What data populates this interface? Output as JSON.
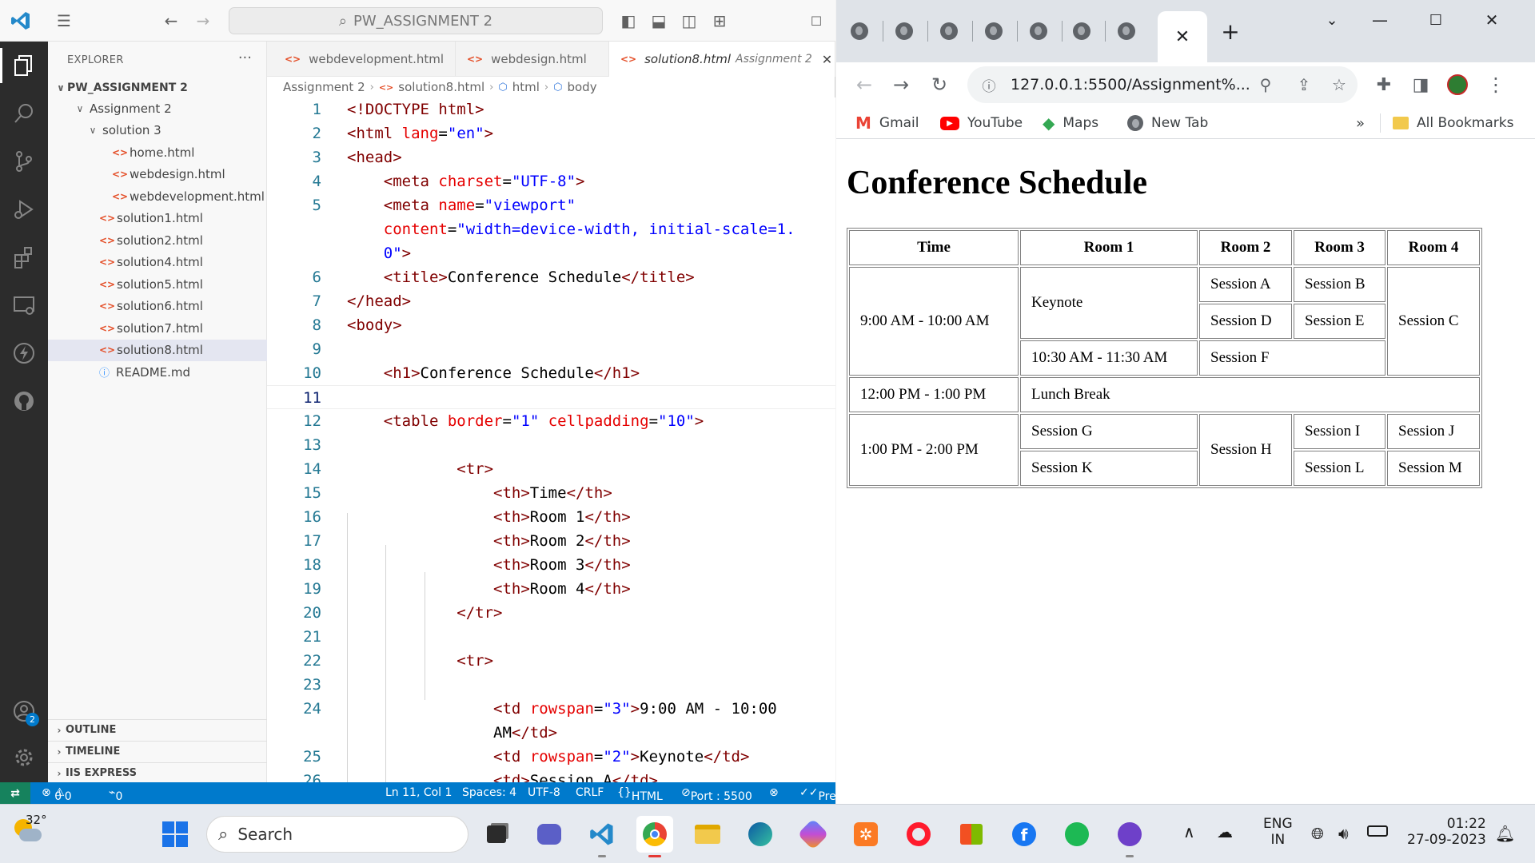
{
  "vscode": {
    "command_center": "PW_ASSIGNMENT 2",
    "explorer": {
      "title": "EXPLORER",
      "root": "PW_ASSIGNMENT 2",
      "tree": [
        {
          "label": "Assignment 2",
          "type": "folder"
        },
        {
          "label": "solution 3",
          "type": "folder"
        },
        {
          "label": "home.html",
          "type": "html"
        },
        {
          "label": "webdesign.html",
          "type": "html"
        },
        {
          "label": "webdevelopment.html",
          "type": "html"
        },
        {
          "label": "solution1.html",
          "type": "html"
        },
        {
          "label": "solution2.html",
          "type": "html"
        },
        {
          "label": "solution4.html",
          "type": "html"
        },
        {
          "label": "solution5.html",
          "type": "html"
        },
        {
          "label": "solution6.html",
          "type": "html"
        },
        {
          "label": "solution7.html",
          "type": "html"
        },
        {
          "label": "solution8.html",
          "type": "html",
          "selected": true
        },
        {
          "label": "README.md",
          "type": "info"
        }
      ],
      "sections": [
        "OUTLINE",
        "TIMELINE",
        "IIS EXPRESS"
      ]
    },
    "tabs": [
      {
        "label": "webdevelopment.html"
      },
      {
        "label": "webdesign.html"
      },
      {
        "label": "solution8.html",
        "sub": "Assignment 2",
        "active": true
      }
    ],
    "breadcrumb": [
      "Assignment 2",
      "solution8.html",
      "html",
      "body"
    ],
    "status": {
      "errors": "0",
      "warnings": "0",
      "ports": "0",
      "position": "Ln 11, Col 1",
      "spaces": "Spaces: 4",
      "encoding": "UTF-8",
      "eol": "CRLF",
      "language": "HTML",
      "port": "Port : 5500",
      "prettier": "Pre"
    },
    "account_badge": "2"
  },
  "browser": {
    "url": "127.0.0.1:5500/Assignment%...",
    "bookmarks": [
      "Gmail",
      "YouTube",
      "Maps",
      "New Tab"
    ],
    "all_bookmarks": "All Bookmarks",
    "page": {
      "heading": "Conference Schedule",
      "headers": [
        "Time",
        "Room 1",
        "Room 2",
        "Room 3",
        "Room 4"
      ],
      "cells": {
        "t1": "9:00 AM - 10:00 AM",
        "keynote": "Keynote",
        "a": "Session A",
        "b": "Session B",
        "c": "Session C",
        "d": "Session D",
        "e": "Session E",
        "t2": "10:30 AM - 11:30 AM",
        "f": "Session F",
        "t3": "12:00 PM - 1:00 PM",
        "lunch": "Lunch Break",
        "t4": "1:00 PM - 2:00 PM",
        "g": "Session G",
        "h": "Session H",
        "i": "Session I",
        "j": "Session J",
        "k": "Session K",
        "l": "Session L",
        "m": "Session M"
      }
    }
  },
  "taskbar": {
    "weather": "32°",
    "search": "Search",
    "lang_top": "ENG",
    "lang_bottom": "IN",
    "time": "01:22",
    "date": "27-09-2023"
  },
  "colors": {
    "vscode_blue": "#007acc",
    "activity_bar": "#2c2c2c",
    "remote_green": "#16825d"
  }
}
